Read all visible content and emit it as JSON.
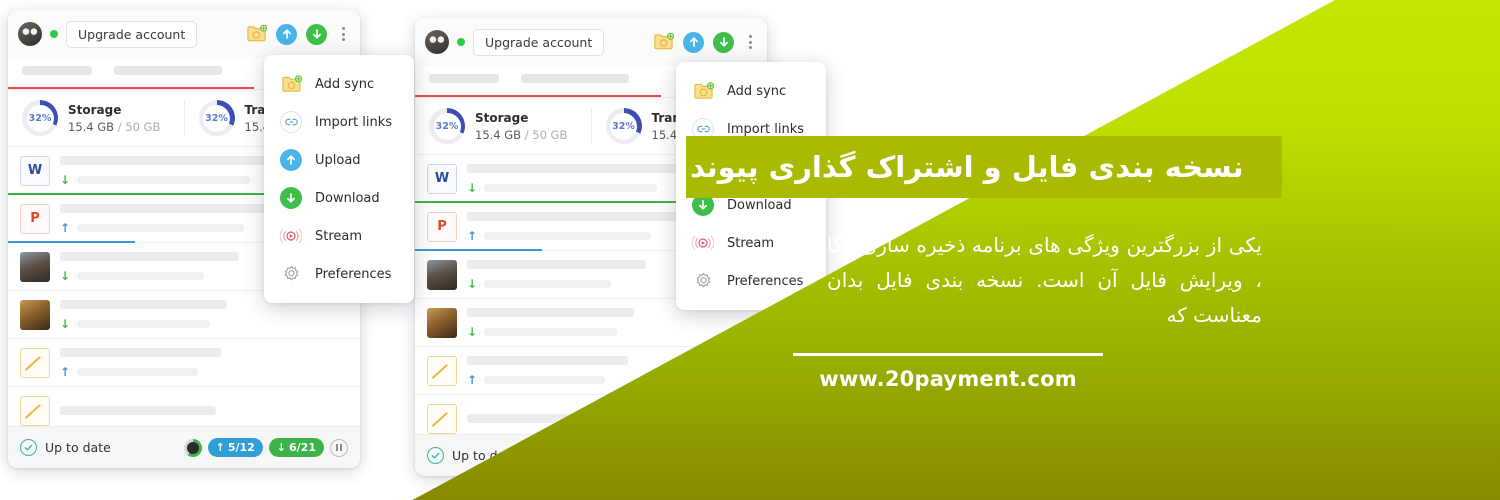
{
  "windows": [
    {
      "id": "window-primary",
      "header": {
        "upgrade_label": "Upgrade account",
        "avatar_name": "user-avatar",
        "online_status": "online",
        "icons": [
          "add-sync-folder-icon",
          "upload-icon",
          "download-icon",
          "more-options-icon"
        ]
      },
      "stats": [
        {
          "percent": "32%",
          "title": "Storage",
          "used": "15.4 GB",
          "separator": " / ",
          "total": "50 GB"
        },
        {
          "percent": "32%",
          "title": "Transfer",
          "used": "15.4",
          "separator": "",
          "total": ""
        }
      ],
      "files": [
        {
          "type": "W",
          "direction": "down",
          "progress": "green"
        },
        {
          "type": "P",
          "direction": "up",
          "progress": "blue"
        },
        {
          "type": "photo-bridge",
          "direction": "down",
          "progress": ""
        },
        {
          "type": "photo-portrait",
          "direction": "down",
          "progress": ""
        },
        {
          "type": "sketch",
          "direction": "up",
          "progress": ""
        },
        {
          "type": "sketch",
          "direction": "",
          "progress": ""
        }
      ],
      "statusbar": {
        "text": "Up to date",
        "upload_badge": "5/12",
        "download_badge": "6/21",
        "pause_label": "pause"
      }
    },
    {
      "id": "window-secondary",
      "header": {
        "upgrade_label": "Upgrade account",
        "avatar_name": "user-avatar",
        "online_status": "online"
      },
      "stats": [
        {
          "percent": "32%",
          "title": "Storage",
          "used": "15.4 GB",
          "separator": " / ",
          "total": "50 GB"
        },
        {
          "percent": "32%",
          "title": "Transfer",
          "used": "15.4",
          "separator": "",
          "total": ""
        }
      ],
      "statusbar": {
        "text": "Up to date"
      }
    }
  ],
  "menu": {
    "items": [
      {
        "label": "Add sync",
        "icon": "add-sync-folder-icon"
      },
      {
        "label": "Import links",
        "icon": "link-icon"
      },
      {
        "label": "Upload",
        "icon": "upload-icon"
      },
      {
        "label": "Download",
        "icon": "download-icon"
      },
      {
        "label": "Stream",
        "icon": "stream-icon"
      },
      {
        "label": "Preferences",
        "icon": "gear-icon"
      }
    ]
  },
  "promo": {
    "headline": "نسخه بندی فایل و اشتراک گذاری پیوند",
    "body": "یکی از بزرگترین ویژگی های برنامه ذخیره سازی مگا ، ویرایش فایل آن است. نسخه بندی فایل بدان معناست که",
    "url": "www.20payment.com"
  },
  "colors": {
    "green_top": "#c6e600",
    "green_bottom": "#878a00",
    "headline_box": "#a9bb00",
    "upload_blue": "#4ab3e8",
    "download_green": "#3fbf4a",
    "accent_red": "#f0474f"
  }
}
